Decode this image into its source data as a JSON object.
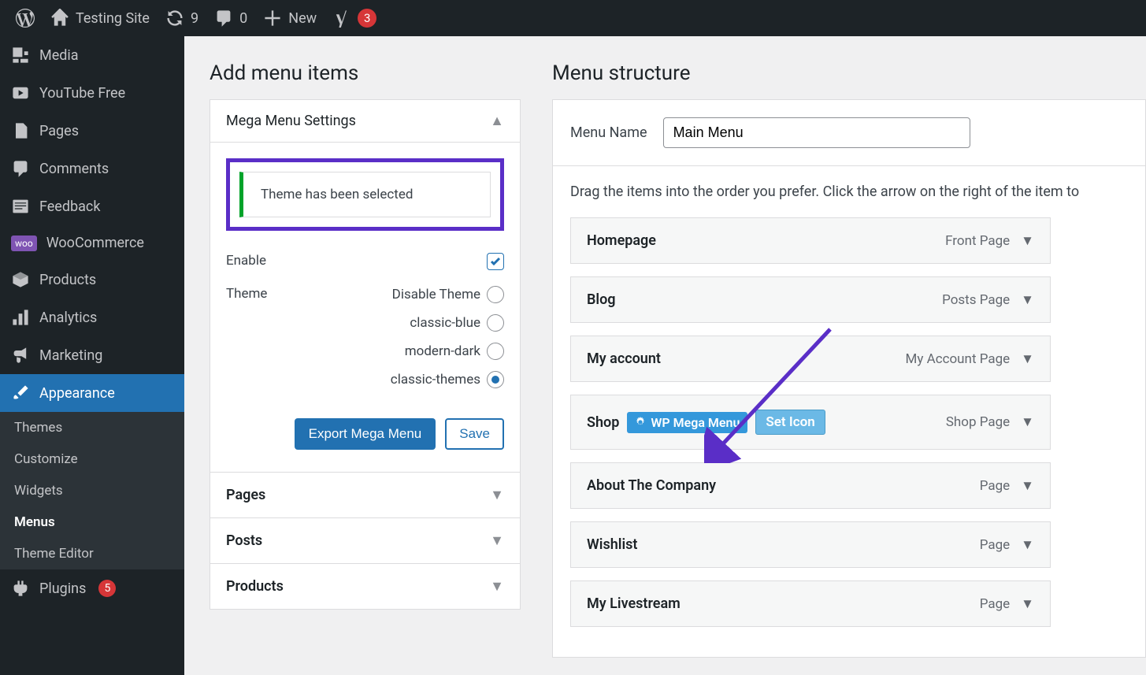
{
  "adminbar": {
    "site_name": "Testing Site",
    "updates_count": "9",
    "comments_count": "0",
    "new_label": "New",
    "yoast_count": "3"
  },
  "sidebar": {
    "items": [
      {
        "label": "Media",
        "icon": "media"
      },
      {
        "label": "YouTube Free",
        "icon": "video"
      },
      {
        "label": "Pages",
        "icon": "pages"
      },
      {
        "label": "Comments",
        "icon": "comment"
      },
      {
        "label": "Feedback",
        "icon": "feedback"
      },
      {
        "label": "WooCommerce",
        "icon": "woo"
      },
      {
        "label": "Products",
        "icon": "products"
      },
      {
        "label": "Analytics",
        "icon": "analytics"
      },
      {
        "label": "Marketing",
        "icon": "marketing"
      },
      {
        "label": "Appearance",
        "icon": "appearance"
      },
      {
        "label": "Plugins",
        "icon": "plugins",
        "count": "5"
      }
    ],
    "submenu": [
      {
        "label": "Themes"
      },
      {
        "label": "Customize"
      },
      {
        "label": "Widgets"
      },
      {
        "label": "Menus"
      },
      {
        "label": "Theme Editor"
      }
    ]
  },
  "left_panel": {
    "heading": "Add menu items",
    "mega_menu_title": "Mega Menu Settings",
    "notice": "Theme has been selected",
    "enable_label": "Enable",
    "theme_label": "Theme",
    "theme_options": [
      "Disable Theme",
      "classic-blue",
      "modern-dark",
      "classic-themes"
    ],
    "selected_theme": "classic-themes",
    "export_btn": "Export Mega Menu",
    "save_btn": "Save",
    "sections": [
      "Pages",
      "Posts",
      "Products"
    ]
  },
  "right_panel": {
    "heading": "Menu structure",
    "name_label": "Menu Name",
    "menu_name_value": "Main Menu",
    "instructions": "Drag the items into the order you prefer. Click the arrow on the right of the item to",
    "items": [
      {
        "title": "Homepage",
        "type": "Front Page"
      },
      {
        "title": "Blog",
        "type": "Posts Page"
      },
      {
        "title": "My account",
        "type": "My Account Page"
      },
      {
        "title": "Shop",
        "type": "Shop Page",
        "mega": true,
        "mega_label": "WP Mega Menu",
        "set_icon_label": "Set Icon"
      },
      {
        "title": "About The Company",
        "type": "Page"
      },
      {
        "title": "Wishlist",
        "type": "Page"
      },
      {
        "title": "My Livestream",
        "type": "Page"
      }
    ]
  }
}
